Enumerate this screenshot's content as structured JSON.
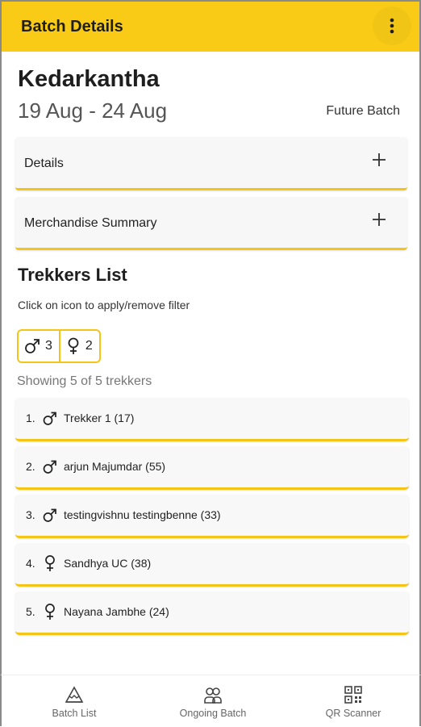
{
  "appbar": {
    "title": "Batch Details",
    "menu_icon": "more-vert-icon",
    "background": "#f9cb17"
  },
  "batch": {
    "trek_name": "Kedarkantha",
    "dates": "19 Aug - 24 Aug",
    "status": "Future Batch"
  },
  "accordions": [
    {
      "label": "Details",
      "icon": "plus-icon"
    },
    {
      "label": "Merchandise Summary",
      "icon": "plus-icon"
    }
  ],
  "trekkers_section": {
    "title": "Trekkers List",
    "hint": "Click on icon to apply/remove filter",
    "filters": [
      {
        "icon": "male-icon",
        "count": "3"
      },
      {
        "icon": "female-icon",
        "count": "2"
      }
    ],
    "showing": "Showing 5 of 5 trekkers",
    "items": [
      {
        "num": "1.",
        "gender_icon": "male-icon",
        "name": "Trekker 1 (17)"
      },
      {
        "num": "2.",
        "gender_icon": "male-icon",
        "name": "arjun Majumdar (55)"
      },
      {
        "num": "3.",
        "gender_icon": "male-icon",
        "name": "testingvishnu testingbenne (33)"
      },
      {
        "num": "4.",
        "gender_icon": "female-icon",
        "name": "Sandhya UC (38)"
      },
      {
        "num": "5.",
        "gender_icon": "female-icon",
        "name": "Nayana Jambhe (24)"
      }
    ]
  },
  "bottom_nav": [
    {
      "label": "Batch List",
      "icon": "mountain-icon"
    },
    {
      "label": "Ongoing Batch",
      "icon": "group-icon"
    },
    {
      "label": "QR Scanner",
      "icon": "qr-code-icon"
    }
  ],
  "accent_color": "#f2c518"
}
